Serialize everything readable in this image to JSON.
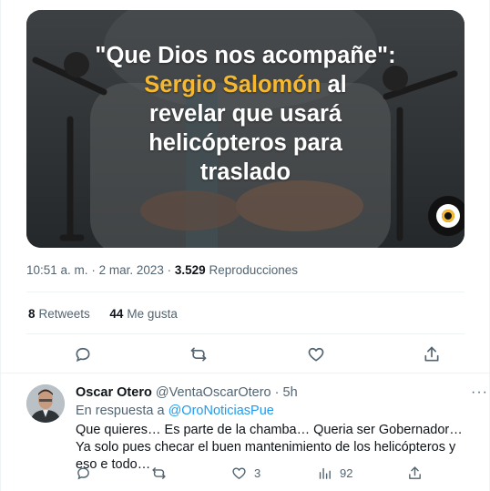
{
  "media": {
    "headline_line1": "\"Que Dios nos acompañe\":",
    "headline_highlight": "Sergio Salomón",
    "headline_line2_rest": " al",
    "headline_line3": "revelar que usará",
    "headline_line4": "helicópteros para",
    "headline_line5": "traslado",
    "highlight_color": "#f5b82e"
  },
  "tweet_meta": {
    "time": "10:51 a. m.",
    "separator": "·",
    "date": "2 mar. 2023",
    "views_count": "3.529",
    "views_label": "Reproducciones"
  },
  "stats": {
    "retweets_count": "8",
    "retweets_label": "Retweets",
    "likes_count": "44",
    "likes_label": "Me gusta"
  },
  "actions": [
    "reply-icon",
    "retweet-icon",
    "like-icon",
    "share-icon"
  ],
  "reply": {
    "name": "Oscar Otero",
    "handle": "@VentaOscarOtero",
    "separator": "·",
    "time": "5h",
    "more": "···",
    "in_reply_to_label": "En respuesta a",
    "in_reply_to_handle": "@OroNoticiasPue",
    "text": "Que quieres… Es parte de la chamba… Queria ser Gobernador… Ya solo pues checar el buen mantenimiento de los helicópteros y eso e todo…",
    "likes": "3",
    "views": "92"
  },
  "colors": {
    "link": "#1d9bf0",
    "muted": "#536471",
    "text": "#0f1419",
    "border": "#eff3f4"
  }
}
